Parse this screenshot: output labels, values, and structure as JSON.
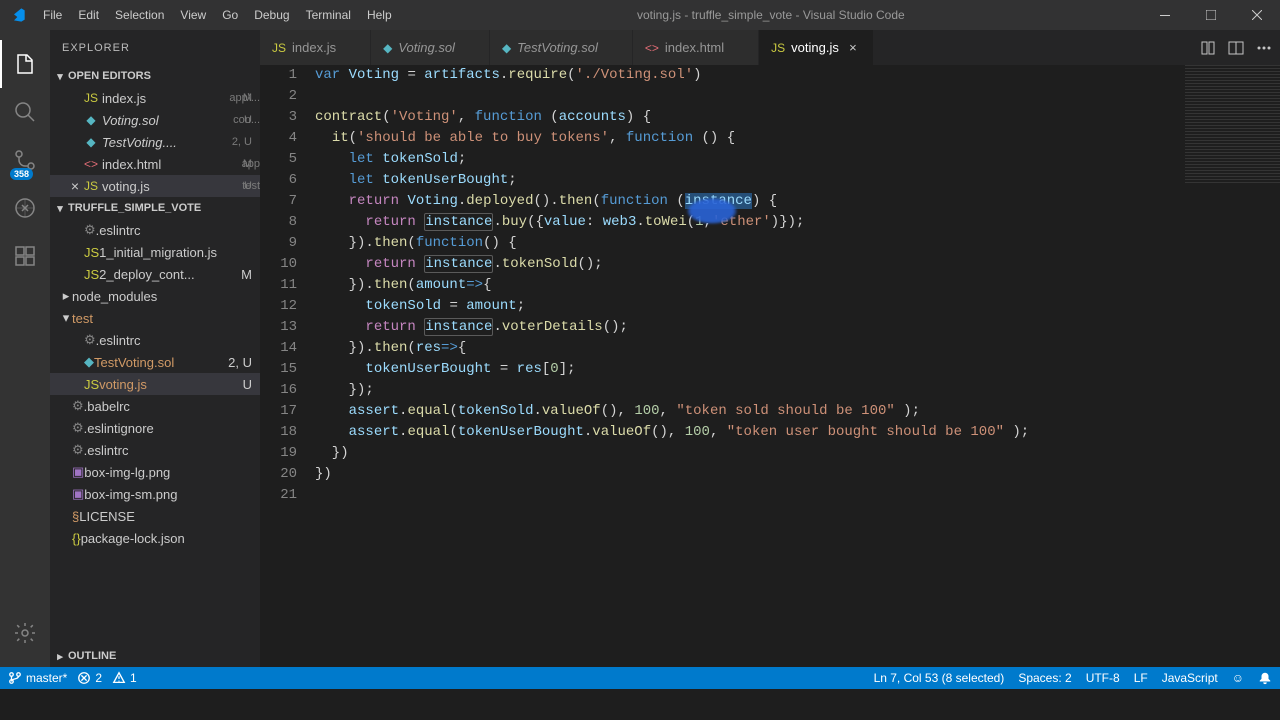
{
  "window": {
    "title": "voting.js - truffle_simple_vote - Visual Studio Code"
  },
  "menu": [
    "File",
    "Edit",
    "Selection",
    "View",
    "Go",
    "Debug",
    "Terminal",
    "Help"
  ],
  "activitybar": {
    "scm_badge": "358"
  },
  "sidebar": {
    "header": "EXPLORER",
    "open_editors_label": "OPEN EDITORS",
    "open_editors": [
      {
        "name": "index.js",
        "hint": "app\\...",
        "status": "M",
        "icon": "js"
      },
      {
        "name": "Voting.sol",
        "hint": "con...",
        "status": "U",
        "icon": "sol",
        "italic": true
      },
      {
        "name": "TestVoting....",
        "hint": "",
        "status": "2, U",
        "icon": "sol",
        "italic": true
      },
      {
        "name": "index.html",
        "hint": "app",
        "status": "M",
        "icon": "html"
      },
      {
        "name": "voting.js",
        "hint": "test",
        "status": "U",
        "icon": "js",
        "active": true,
        "close": true
      }
    ],
    "project_label": "TRUFFLE_SIMPLE_VOTE",
    "tree": [
      {
        "name": ".eslintrc",
        "indent": 1,
        "icon": "conf"
      },
      {
        "name": "1_initial_migration.js",
        "indent": 1,
        "icon": "js"
      },
      {
        "name": "2_deploy_cont...",
        "indent": 1,
        "icon": "js",
        "status": "M"
      },
      {
        "name": "node_modules",
        "indent": 0,
        "icon": "folder",
        "chev": "right"
      },
      {
        "name": "test",
        "indent": 0,
        "icon": "folder",
        "chev": "down",
        "orange": true
      },
      {
        "name": ".eslintrc",
        "indent": 1,
        "icon": "conf"
      },
      {
        "name": "TestVoting.sol",
        "indent": 1,
        "icon": "sol",
        "status": "2, U",
        "orange": true
      },
      {
        "name": "voting.js",
        "indent": 1,
        "icon": "js",
        "status": "U",
        "orange": true,
        "active": true
      },
      {
        "name": ".babelrc",
        "indent": 0,
        "icon": "conf"
      },
      {
        "name": ".eslintignore",
        "indent": 0,
        "icon": "conf"
      },
      {
        "name": ".eslintrc",
        "indent": 0,
        "icon": "conf"
      },
      {
        "name": "box-img-lg.png",
        "indent": 0,
        "icon": "img"
      },
      {
        "name": "box-img-sm.png",
        "indent": 0,
        "icon": "img"
      },
      {
        "name": "LICENSE",
        "indent": 0,
        "icon": "lic"
      },
      {
        "name": "package-lock.json",
        "indent": 0,
        "icon": "json"
      }
    ],
    "outline_label": "OUTLINE"
  },
  "tabs": [
    {
      "name": "index.js",
      "icon": "js"
    },
    {
      "name": "Voting.sol",
      "icon": "sol",
      "italic": true
    },
    {
      "name": "TestVoting.sol",
      "icon": "sol",
      "italic": true
    },
    {
      "name": "index.html",
      "icon": "html"
    },
    {
      "name": "voting.js",
      "icon": "js",
      "active": true
    }
  ],
  "code": {
    "lines": 21
  },
  "statusbar": {
    "branch": "master*",
    "errors": "2",
    "warnings": "1",
    "cursor": "Ln 7, Col 53 (8 selected)",
    "spaces": "Spaces: 2",
    "encoding": "UTF-8",
    "eol": "LF",
    "lang": "JavaScript"
  }
}
